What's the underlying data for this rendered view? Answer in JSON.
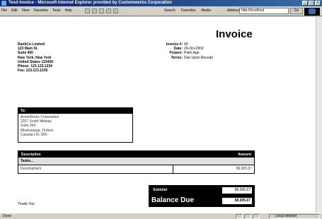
{
  "window": {
    "title": "Tesd Invoice - Microsoft Internet Explorer provided by Customworks Corporation",
    "min": "_",
    "max": "□",
    "close": "×"
  },
  "menu": [
    "File",
    "Edit",
    "View",
    "Favorites",
    "Tools",
    "Help"
  ],
  "toolbar": {
    "search": "Search",
    "favorites": "Favorites",
    "media": "Media",
    "address_label": "Address",
    "address_value": "http://localhost",
    "go": "Go"
  },
  "invoice": {
    "title": "Invoice",
    "company_lines": [
      "RankCo Limited",
      "123 Main St.",
      "Suite 400",
      "New York, New York",
      "United States 123456",
      "Phone: 123.123.1234",
      "Fax: 123.123.1235"
    ],
    "meta": [
      {
        "k": "Invoice #:",
        "v": "49"
      },
      {
        "k": "Date:",
        "v": "29-Oct-2002"
      },
      {
        "k": "Project:",
        "v": "Palm App"
      },
      {
        "k": "Terms:",
        "v": "Due Upon Receipt"
      }
    ],
    "to_label": "To:",
    "to_lines": [
      "AcmeWorks Corporation",
      "2207 South Midway",
      "Suite 304",
      "Mississauga, Ontario",
      "Canada L5L 3R6"
    ],
    "items_head_desc": "Description",
    "items_head_amount": "Amount",
    "section": "Tasks...",
    "line_desc": "Development",
    "line_amount": "$9,005.67",
    "subtotal_label": "Subtotal",
    "subtotal_value": "$9,005.67",
    "balance_label": "Balance Due",
    "balance_value": "$9,005.67",
    "thanks": "Thank You"
  },
  "status": {
    "text": "Done",
    "zone": "Local intranet"
  }
}
